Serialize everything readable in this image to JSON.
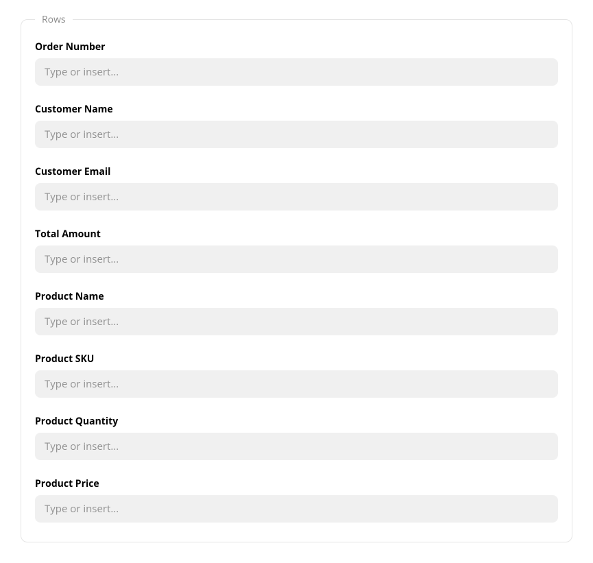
{
  "section": {
    "legend": "Rows"
  },
  "fields": [
    {
      "label": "Order Number",
      "placeholder": "Type or insert..."
    },
    {
      "label": "Customer Name",
      "placeholder": "Type or insert..."
    },
    {
      "label": "Customer Email",
      "placeholder": "Type or insert..."
    },
    {
      "label": "Total Amount",
      "placeholder": "Type or insert..."
    },
    {
      "label": "Product Name",
      "placeholder": "Type or insert..."
    },
    {
      "label": "Product SKU",
      "placeholder": "Type or insert..."
    },
    {
      "label": "Product Quantity",
      "placeholder": "Type or insert..."
    },
    {
      "label": "Product Price",
      "placeholder": "Type or insert..."
    }
  ]
}
